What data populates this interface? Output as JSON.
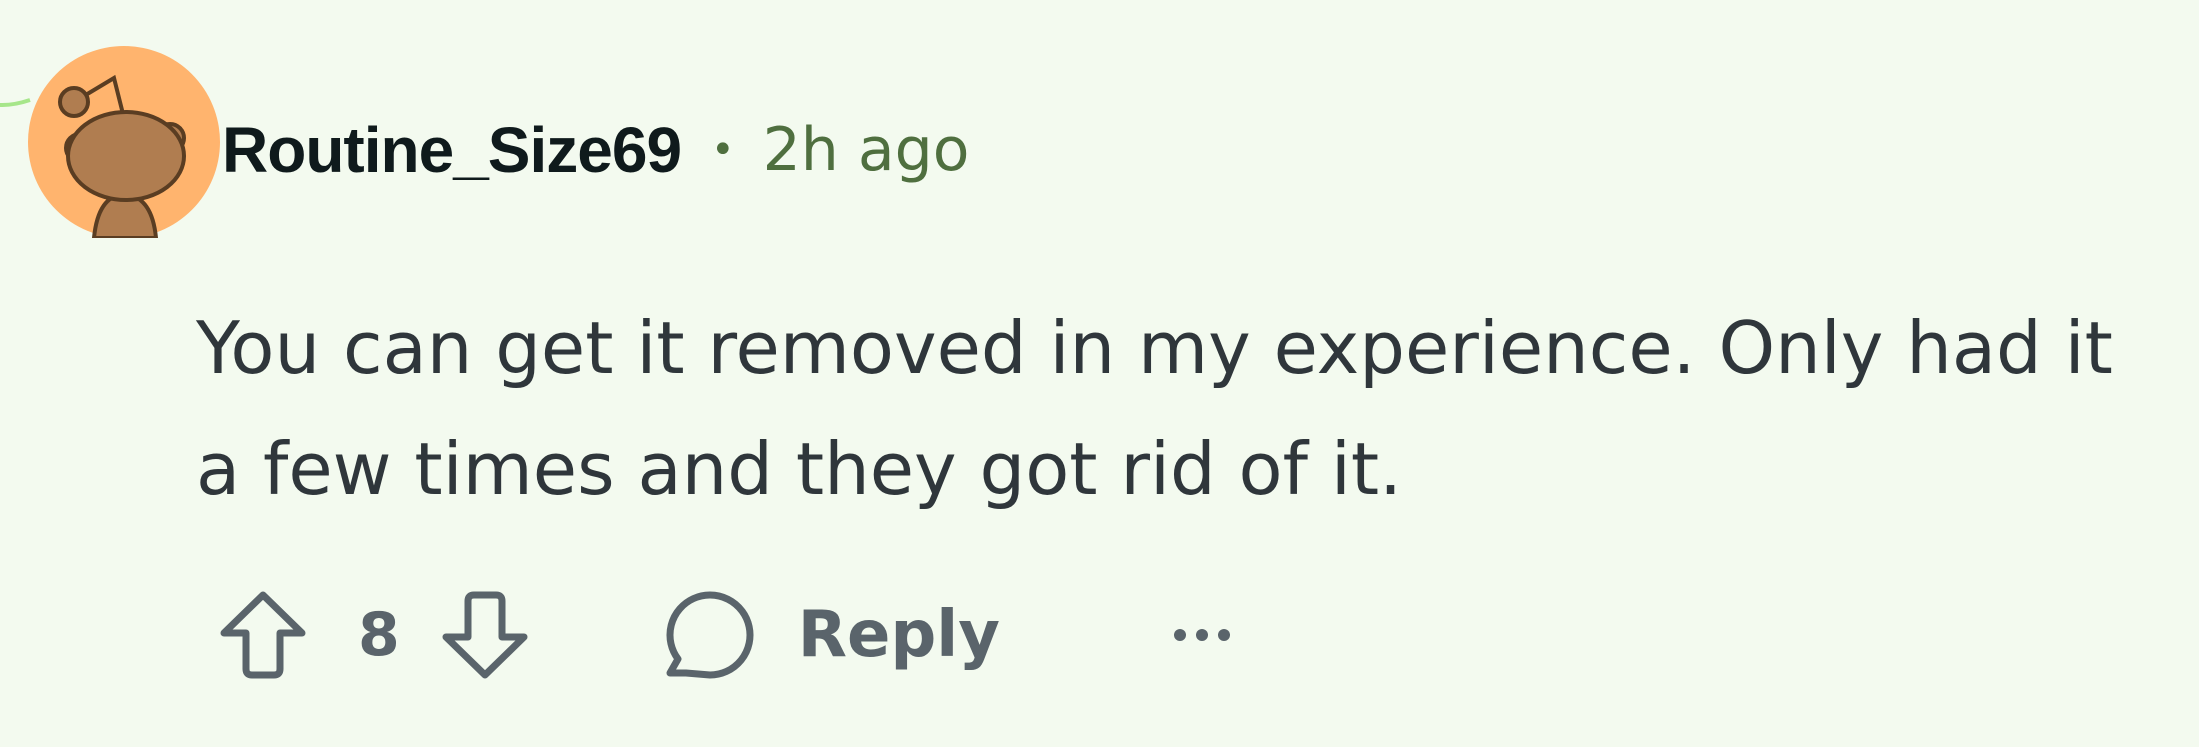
{
  "comment": {
    "username": "Routine_Size69",
    "separator": "•",
    "time_ago": "2h ago",
    "body": "You can get it removed in my experience. Only had it a few times and they got rid of it.",
    "score": "8",
    "reply_label": "Reply",
    "avatar_icon": "reddit-snoo-avatar",
    "more_icon": "ellipsis-icon"
  },
  "colors": {
    "background": "#f3faef",
    "avatar_bg": "#ffb46e",
    "snoo_body": "#b07d50",
    "meta_green": "#4f6f3f",
    "text": "#2f363b",
    "icon_gray": "#5a646b"
  }
}
